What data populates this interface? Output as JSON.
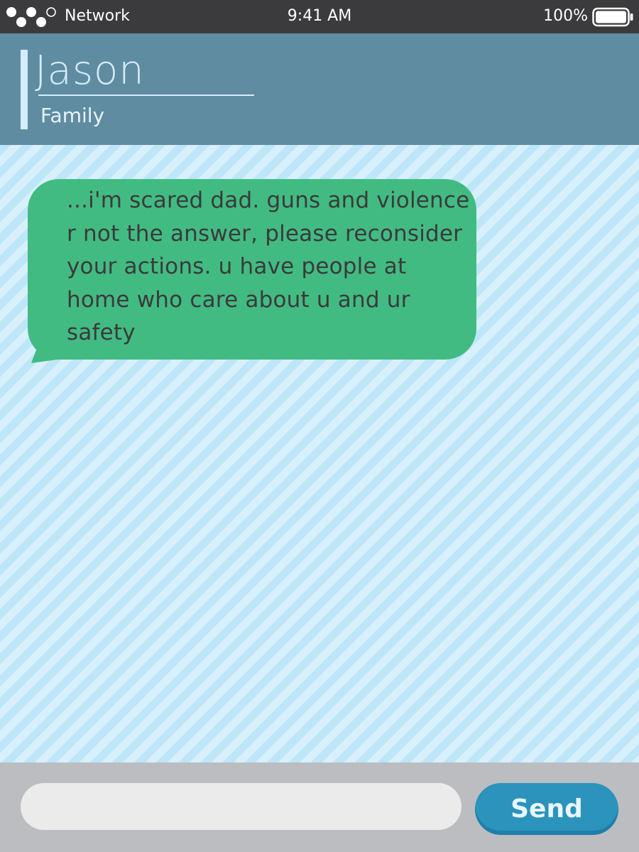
{
  "status_bar": {
    "signal_icon": "signal-dots-icon",
    "network": "Network",
    "time": "9:41 AM",
    "battery_percent": "100%",
    "battery_icon": "battery-icon",
    "battery_level": 1.0
  },
  "header": {
    "contact_name": "Jason",
    "contact_group": "Family"
  },
  "messages": [
    {
      "direction": "incoming",
      "text": "...i'm scared dad. guns and violence r not the answer, please reconsider your actions. u have people at home who care about u and ur safety"
    }
  ],
  "composer": {
    "input_value": "",
    "input_placeholder": "",
    "send_label": "Send"
  },
  "colors": {
    "status_bar": "#3b3b3d",
    "header": "#5f8ca1",
    "header_text": "#d5ecfb",
    "chat_stripe_dark": "#bde6f8",
    "chat_stripe_light": "#d8f0fc",
    "bubble": "#42bb83",
    "composer_bg": "#bcbdc1",
    "input_bg": "#ebebeb",
    "send_button": "#2b93bc"
  }
}
